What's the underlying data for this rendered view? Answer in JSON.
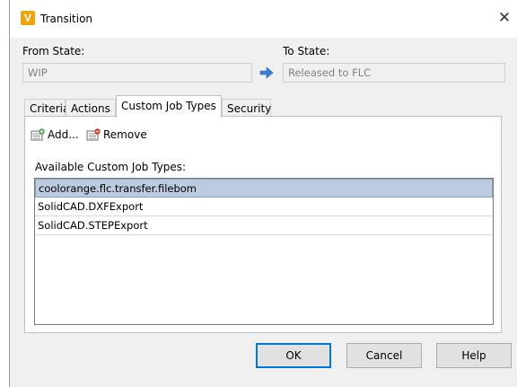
{
  "window": {
    "title": "Transition",
    "close_glyph": "✕",
    "app_icon": "vault-v-icon"
  },
  "from_state": {
    "label": "From State:",
    "value": "WIP"
  },
  "to_state": {
    "label": "To State:",
    "value": "Released to FLC"
  },
  "tabs": [
    {
      "label": "Criteria"
    },
    {
      "label": "Actions"
    },
    {
      "label": "Custom Job Types"
    },
    {
      "label": "Security"
    }
  ],
  "active_tab": "Custom Job Types",
  "toolbar": {
    "add_label": "Add...",
    "remove_label": "Remove"
  },
  "custom_jobs": {
    "label": "Available Custom Job Types:",
    "items": [
      "coolorange.flc.transfer.filebom",
      "SolidCAD.DXFExport",
      "SolidCAD.STEPExport"
    ],
    "selected_index": 0
  },
  "buttons": {
    "ok": "OK",
    "cancel": "Cancel",
    "help": "Help"
  },
  "colors": {
    "accent": "#0078d7",
    "selection": "#bdcbe0",
    "arrow": "#3c7fd8",
    "app_icon": "#f0a30a"
  }
}
